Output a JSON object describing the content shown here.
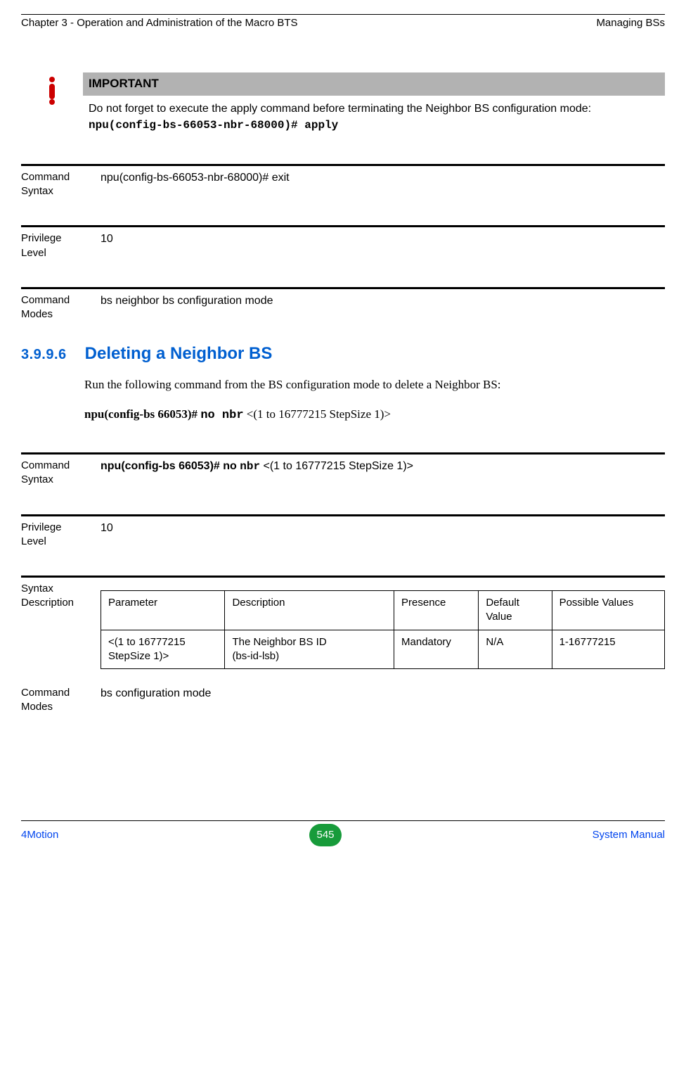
{
  "header": {
    "left": "Chapter 3 - Operation and Administration of the Macro BTS",
    "right": "Managing BSs"
  },
  "important": {
    "label": "IMPORTANT",
    "body_prefix": "Do not forget to execute the apply command before terminating the Neighbor BS configuration mode: ",
    "body_code": "npu(config-bs-66053-nbr-68000)# apply"
  },
  "block1": {
    "cmd_syntax_label": "Command Syntax",
    "cmd_syntax_value": "npu(config-bs-66053-nbr-68000)# exit",
    "priv_label": "Privilege Level",
    "priv_value": "10",
    "modes_label": "Command Modes",
    "modes_value": "bs neighbor bs configuration mode"
  },
  "section": {
    "num": "3.9.9.6",
    "title": "Deleting a Neighbor BS",
    "para": "Run the following command from the BS configuration mode to delete a Neighbor BS:",
    "cmd_prefix": "npu(config-bs 66053)# ",
    "cmd_bold": "no nbr",
    "cmd_suffix": " <(1 to 16777215 StepSize 1)>"
  },
  "block2": {
    "cmd_syntax_label": "Command Syntax",
    "cmd_syntax_prefix": "npu(config-bs 66053)#  no ",
    "cmd_syntax_mono": "nbr",
    "cmd_syntax_suffix": " <(1 to 16777215 StepSize 1)>",
    "priv_label": "Privilege Level",
    "priv_value": "10",
    "syntax_desc_label": "Syntax Description",
    "table": {
      "headers": [
        "Parameter",
        "Description",
        "Presence",
        "Default Value",
        "Possible Values"
      ],
      "row": {
        "parameter": "<(1 to 16777215 StepSize 1)>",
        "desc_line1": "The Neighbor BS ID",
        "desc_line2": "(bs-id-lsb)",
        "presence": "Mandatory",
        "default": "N/A",
        "possible": "1-16777215"
      }
    },
    "modes_label": "Command Modes",
    "modes_value": "bs configuration mode"
  },
  "footer": {
    "left": "4Motion",
    "page": "545",
    "right": "System Manual"
  }
}
